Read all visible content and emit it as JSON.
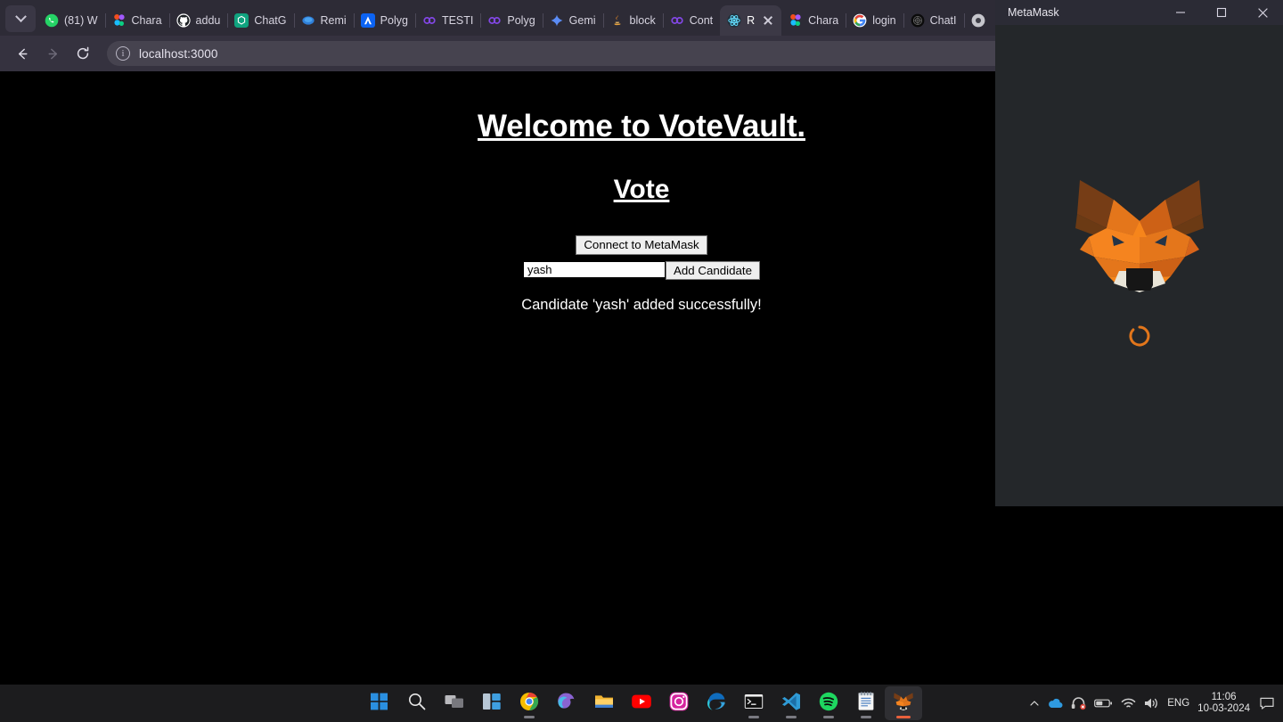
{
  "browser": {
    "tablist_button": "tab-search",
    "nav": {
      "back": "Back",
      "forward": "Forward",
      "reload": "Reload"
    },
    "omnibox": {
      "url": "localhost:3000",
      "site_info": "site-information"
    },
    "tabs": [
      {
        "label": "(81) W",
        "icon": "whatsapp-icon",
        "active": false
      },
      {
        "label": "Chara",
        "icon": "figma-icon",
        "active": false
      },
      {
        "label": "addu",
        "icon": "github-icon",
        "active": false
      },
      {
        "label": "ChatG",
        "icon": "chatgpt-icon",
        "active": false
      },
      {
        "label": "Remi",
        "icon": "remix-icon",
        "active": false
      },
      {
        "label": "Polyg",
        "icon": "alchemy-icon",
        "active": false
      },
      {
        "label": "TESTI",
        "icon": "polygon-icon",
        "active": false
      },
      {
        "label": "Polyg",
        "icon": "polygon-icon",
        "active": false
      },
      {
        "label": "Gemi",
        "icon": "gemini-icon",
        "active": false
      },
      {
        "label": "block",
        "icon": "java-icon",
        "active": false
      },
      {
        "label": "Cont",
        "icon": "polygon-icon",
        "active": false
      },
      {
        "label": "R",
        "icon": "react-icon",
        "active": true
      },
      {
        "label": "Chara",
        "icon": "figma-icon",
        "active": false
      },
      {
        "label": "login",
        "icon": "google-icon",
        "active": false
      },
      {
        "label": "ChatI",
        "icon": "dark-circle-icon",
        "active": false
      },
      {
        "label": "",
        "icon": "chrome-icon",
        "active": false
      }
    ]
  },
  "page": {
    "heading": "Welcome to VoteVault.",
    "subheading": "Vote",
    "connect_button": "Connect to MetaMask",
    "candidate_input_value": "yash",
    "candidate_input_placeholder": "",
    "add_button": "Add Candidate",
    "status_message": "Candidate 'yash' added successfully!",
    "colors": {
      "background": "#000000",
      "text": "#ffffff"
    }
  },
  "metamask": {
    "title": "MetaMask",
    "window_buttons": {
      "minimize": "minimize",
      "maximize": "maximize",
      "close": "close"
    },
    "logo": "metamask-fox-logo",
    "spinner": "loading-spinner",
    "colors": {
      "background": "#24272a",
      "titlebar": "#2b2b35",
      "accent": "#e2761b"
    }
  },
  "taskbar": {
    "items": [
      {
        "name": "start-button",
        "icon": "windows-logo-icon",
        "running": false,
        "active": false
      },
      {
        "name": "search-button",
        "icon": "search-icon",
        "running": false,
        "active": false
      },
      {
        "name": "task-view-button",
        "icon": "task-view-icon",
        "running": false,
        "active": false
      },
      {
        "name": "widgets-button",
        "icon": "widgets-icon",
        "running": false,
        "active": false
      },
      {
        "name": "taskbar-chrome",
        "icon": "chrome-icon",
        "running": true,
        "active": false
      },
      {
        "name": "taskbar-copilot",
        "icon": "copilot-icon",
        "running": false,
        "active": false
      },
      {
        "name": "taskbar-file-explorer",
        "icon": "folder-icon",
        "running": false,
        "active": false
      },
      {
        "name": "taskbar-youtube",
        "icon": "youtube-icon",
        "running": false,
        "active": false
      },
      {
        "name": "taskbar-instagram",
        "icon": "instagram-icon",
        "running": false,
        "active": false
      },
      {
        "name": "taskbar-edge",
        "icon": "edge-icon",
        "running": false,
        "active": false
      },
      {
        "name": "taskbar-terminal",
        "icon": "terminal-icon",
        "running": true,
        "active": false
      },
      {
        "name": "taskbar-vscode",
        "icon": "vscode-icon",
        "running": true,
        "active": false
      },
      {
        "name": "taskbar-spotify",
        "icon": "spotify-icon",
        "running": true,
        "active": false
      },
      {
        "name": "taskbar-notepad",
        "icon": "notepad-icon",
        "running": true,
        "active": false
      },
      {
        "name": "taskbar-metamask",
        "icon": "metamask-fox-icon",
        "running": true,
        "active": true
      }
    ],
    "tray": {
      "overflow": "show-hidden-icons",
      "onedrive": "onedrive-icon",
      "headset": "headset-muted-icon",
      "battery": "battery-icon",
      "wifi": "wifi-icon",
      "volume": "volume-icon",
      "language": "ENG",
      "time": "11:06",
      "date": "10-03-2024",
      "notifications": "notification-icon"
    }
  }
}
